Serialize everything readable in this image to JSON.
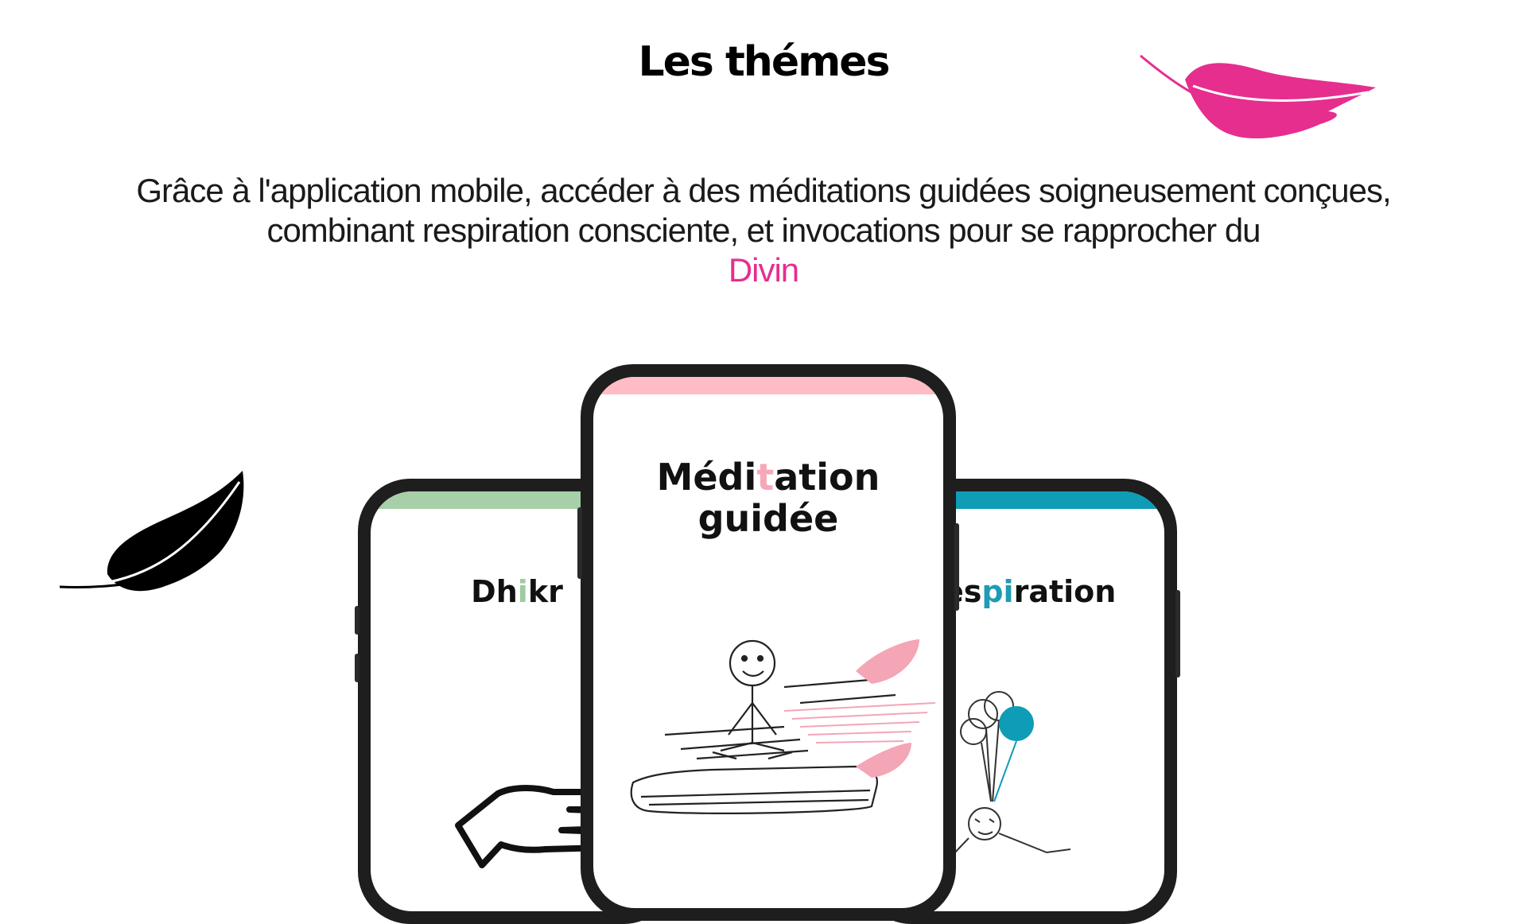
{
  "title": "Les thémes",
  "intro": {
    "text": "Grâce à l'application mobile, accéder à des méditations guidées soigneusement conçues, combinant respiration consciente, et invocations pour se rapprocher du",
    "accent_word": "Divin",
    "accent_color": "#e62e8f"
  },
  "phones": {
    "left": {
      "bar_color": "#a7cfa8",
      "title_parts": [
        "Dh",
        "i",
        "kr"
      ],
      "icon": "prayer-beads-hand-icon"
    },
    "center": {
      "bar_color": "#ffbcc6",
      "line1_parts": [
        "Médi",
        "t",
        "ation"
      ],
      "line2": "guidée",
      "icon": "meditation-flying-carpet-icon"
    },
    "right": {
      "bar_color": "#0e9cb6",
      "title_parts": [
        "Res",
        "pi",
        "ration"
      ],
      "icon": "balloons-floating-person-icon"
    }
  },
  "decor": {
    "feather_pink_color": "#e62e8f",
    "feather_black_color": "#000000"
  }
}
